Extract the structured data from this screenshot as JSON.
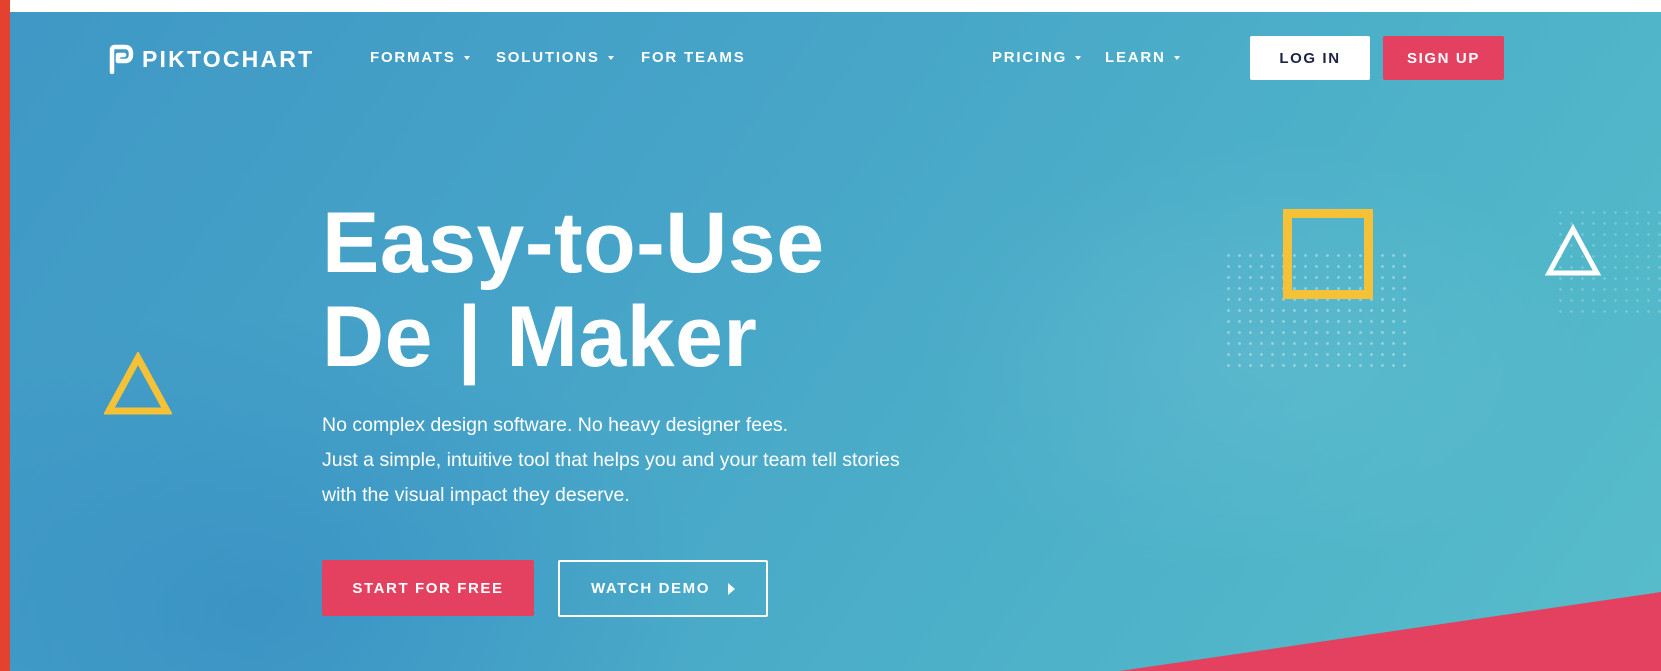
{
  "brand": {
    "name": "PIKTOCHART",
    "colors": {
      "accent_pink": "#e3415f",
      "accent_yellow": "#f4c137",
      "hero_blue": "#47a5c8",
      "login_text": "#1d2346"
    }
  },
  "nav": {
    "left_items": [
      {
        "label": "FORMATS",
        "has_dropdown": true
      },
      {
        "label": "SOLUTIONS",
        "has_dropdown": true
      },
      {
        "label": "FOR TEAMS",
        "has_dropdown": false
      }
    ],
    "right_items": [
      {
        "label": "PRICING",
        "has_dropdown": true
      },
      {
        "label": "LEARN",
        "has_dropdown": true
      }
    ],
    "login_label": "LOG IN",
    "signup_label": "SIGN UP"
  },
  "hero": {
    "headline_line1": "Easy-to-Use",
    "headline_line2": "De | Maker",
    "subtext_line1": "No complex design software. No heavy designer fees.",
    "subtext_line2": "Just a simple, intuitive tool that helps you and your team tell stories",
    "subtext_line3": "with the visual impact they deserve.",
    "cta_primary": "START FOR FREE",
    "cta_secondary": "WATCH DEMO"
  },
  "icons": {
    "logo": "piktochart-logo-icon",
    "dropdown": "caret-down-icon",
    "play": "play-caret-icon",
    "decor_triangles": [
      "yellow-triangle-outline-icon",
      "white-triangle-outline-icon"
    ],
    "decor_square": "yellow-square-outline-icon"
  }
}
